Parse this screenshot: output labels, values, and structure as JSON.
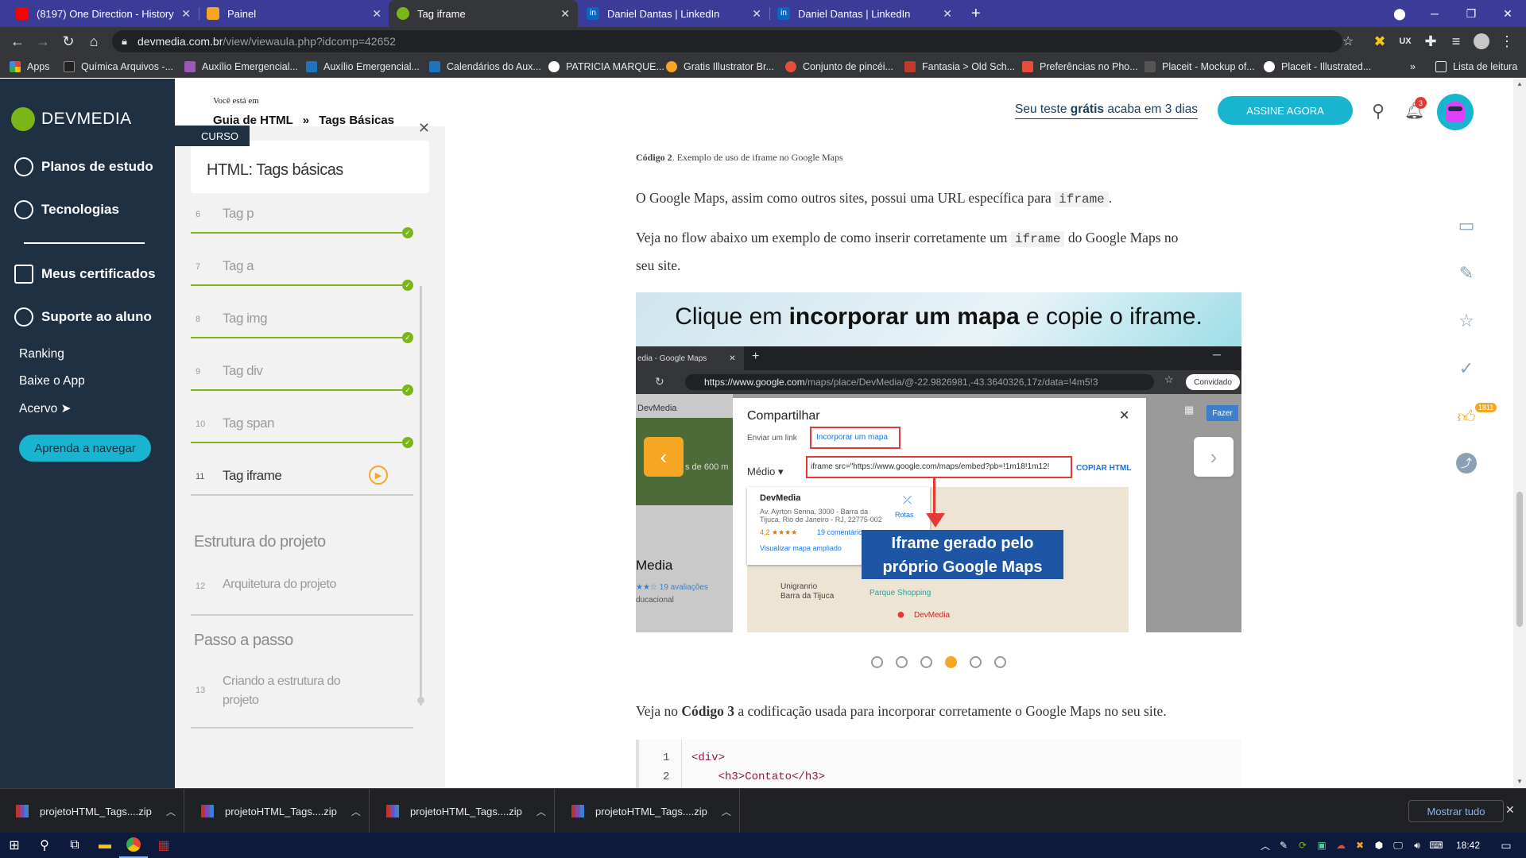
{
  "browser": {
    "tabs": [
      {
        "title": "(8197) One Direction - History (C",
        "favicon_color": "#ff0000"
      },
      {
        "title": "Painel",
        "favicon_color": "#f5a623"
      },
      {
        "title": "Tag iframe",
        "favicon_color": "#7cb518"
      },
      {
        "title": "Daniel Dantas | LinkedIn",
        "favicon_color": "#0a66c2"
      },
      {
        "title": "Daniel Dantas | LinkedIn",
        "favicon_color": "#0a66c2"
      }
    ],
    "new_tab": "+",
    "url_host": "devmedia.com.br",
    "url_path": "/view/viewaula.php?idcomp=42652",
    "bookmarks": [
      "Apps",
      "Química Arquivos -...",
      "Auxílio Emergencial...",
      "Auxílio Emergencial...",
      "Calendários do Aux...",
      "PATRICIA MARQUE...",
      "Gratis Illustrator Br...",
      "Conjunto de pincéi...",
      "Fantasia > Old Sch...",
      "Preferências no Pho...",
      "Placeit - Mockup of...",
      "Placeit - Illustrated..."
    ],
    "bookmarks_more": "»",
    "reading_list": "Lista de leitura"
  },
  "sidebar": {
    "logo": "DEVMEDIA",
    "main_items": [
      "Planos de estudo",
      "Tecnologias",
      "Meus certificados",
      "Suporte ao aluno"
    ],
    "sub_items": [
      "Ranking",
      "Baixe o App",
      "Acervo ➤"
    ],
    "learn_button": "Aprenda a navegar"
  },
  "header": {
    "breadcrumb_label": "Você está em",
    "breadcrumb_1": "Guia de HTML",
    "breadcrumb_sep": "»",
    "breadcrumb_2": "Tags Básicas",
    "trial_pre": "Seu teste ",
    "trial_bold": "grátis",
    "trial_post": " acaba em 3 dias",
    "subscribe": "ASSINE AGORA",
    "notifications": "3"
  },
  "course": {
    "tag": "CURSO",
    "title": "HTML: Tags básicas",
    "lessons": [
      {
        "num": "6",
        "title": "Tag p",
        "done": true
      },
      {
        "num": "7",
        "title": "Tag a",
        "done": true
      },
      {
        "num": "8",
        "title": "Tag img",
        "done": true
      },
      {
        "num": "9",
        "title": "Tag div",
        "done": true
      },
      {
        "num": "10",
        "title": "Tag span",
        "done": true
      },
      {
        "num": "11",
        "title": "Tag iframe",
        "done": false
      }
    ],
    "section_1": "Estrutura do projeto",
    "lesson_12_num": "12",
    "lesson_12": "Arquitetura do projeto",
    "section_2": "Passo a passo",
    "lesson_13_num": "13",
    "lesson_13_a": "Criando a estrutura do",
    "lesson_13_b": "projeto"
  },
  "content": {
    "caption_bold": "Código 2",
    "caption_rest": ". Exemplo de uso de iframe no Google Maps",
    "p1_a": "O Google Maps, assim como outros sites, possui uma URL específica para ",
    "p1_code": "iframe",
    "p1_b": ".",
    "p2_a": "Veja no flow abaixo um exemplo de como inserir corretamente um ",
    "p2_code": "iframe",
    "p2_b": " do Google Maps no",
    "p2_c": "seu site.",
    "slide_title_a": "Clique em ",
    "slide_title_bold": "incorporar um mapa",
    "slide_title_b": " e copie o iframe.",
    "slide": {
      "tab": "edia - Google Maps",
      "url_a": "https://www.google.com",
      "url_b": "/maps/place/DevMedia/@-22.9826981,-43.3640326,17z/data=!4m5!3",
      "guest": "Convidado",
      "dialog_title": "Compartilhar",
      "tab_link": "Enviar um link",
      "tab_embed": "Incorporar um mapa",
      "size": "Médio ▾",
      "iframe_code": "iframe src=\"https://www.google.com/maps/embed?pb=!1m18!1m12!",
      "copy": "COPIAR HTML",
      "place": "DevMedia",
      "address_1": "Av. Ayrton Senna, 3000 - Barra da",
      "address_2": "Tijuca, Rio de Janeiro - RJ, 22775-002",
      "rating": "4,2 ★★★★",
      "reviews": "19 comentários",
      "routes": "Rotas",
      "expand": "Visualizar mapa ampliado",
      "callout_1": "Iframe gerado pelo",
      "callout_2": "próprio Google Maps",
      "left_label": "DevMedia",
      "left_media": "Media",
      "left_reviews": "19 avaliações",
      "left_edu": "ducacional",
      "left_dist": "s de 600 m",
      "fazer": "Fazer",
      "map_1": "Unigranrio",
      "map_2": "Barra da Tijuca",
      "map_3": "Parque Shopping",
      "map_pin": "DevMedia"
    },
    "dots_active": 3,
    "p3_a": "Veja no ",
    "p3_bold": "Código 3",
    "p3_b": " a codificação usada para incorporar corretamente o Google Maps no seu site.",
    "code_lines": [
      {
        "n": "1",
        "text": "<div>"
      },
      {
        "n": "2",
        "text": "    <h3>Contato</h3>"
      }
    ]
  },
  "right_rail": {
    "likes": "1811"
  },
  "downloads": {
    "items": [
      "projetoHTML_Tags....zip",
      "projetoHTML_Tags....zip",
      "projetoHTML_Tags....zip",
      "projetoHTML_Tags....zip"
    ],
    "show_all": "Mostrar tudo"
  },
  "taskbar": {
    "time": "18:42"
  }
}
